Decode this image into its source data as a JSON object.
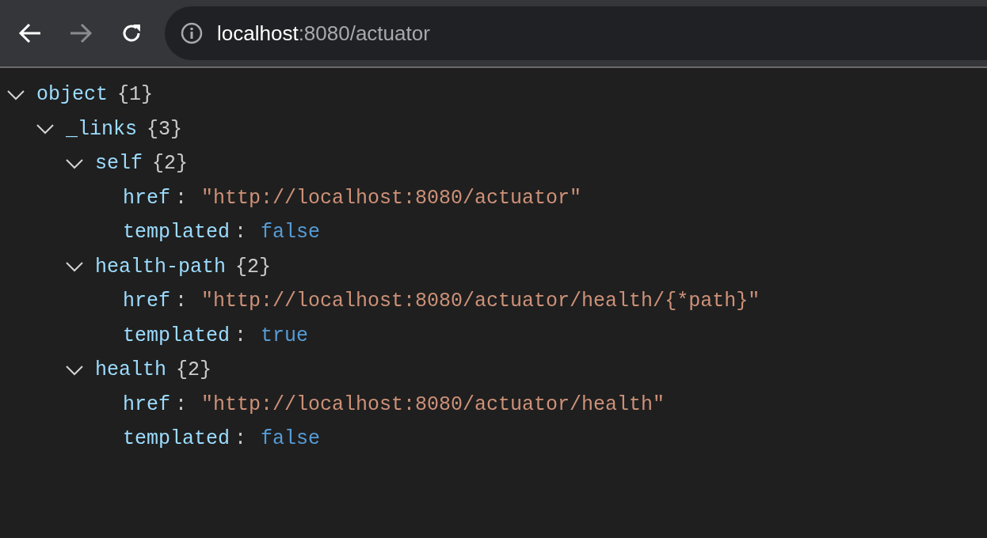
{
  "toolbar": {
    "url": {
      "host": "localhost",
      "path": ":8080/actuator"
    }
  },
  "tree": [
    {
      "key": "object",
      "count": "{1}",
      "expanded": true,
      "children": [
        {
          "key": "_links",
          "count": "{3}",
          "expanded": true,
          "children": [
            {
              "key": "self",
              "count": "{2}",
              "expanded": true,
              "children": [
                {
                  "key": "href",
                  "separator": ":",
                  "kind": "string",
                  "value": "\"http://localhost:8080/actuator\""
                },
                {
                  "key": "templated",
                  "separator": ":",
                  "kind": "boolean",
                  "value": "false"
                }
              ]
            },
            {
              "key": "health-path",
              "count": "{2}",
              "expanded": true,
              "children": [
                {
                  "key": "href",
                  "separator": ":",
                  "kind": "string",
                  "value": "\"http://localhost:8080/actuator/health/{*path}\""
                },
                {
                  "key": "templated",
                  "separator": ":",
                  "kind": "boolean",
                  "value": "true"
                }
              ]
            },
            {
              "key": "health",
              "count": "{2}",
              "expanded": true,
              "children": [
                {
                  "key": "href",
                  "separator": ":",
                  "kind": "string",
                  "value": "\"http://localhost:8080/actuator/health\""
                },
                {
                  "key": "templated",
                  "separator": ":",
                  "kind": "boolean",
                  "value": "false"
                }
              ]
            }
          ]
        }
      ]
    }
  ]
}
